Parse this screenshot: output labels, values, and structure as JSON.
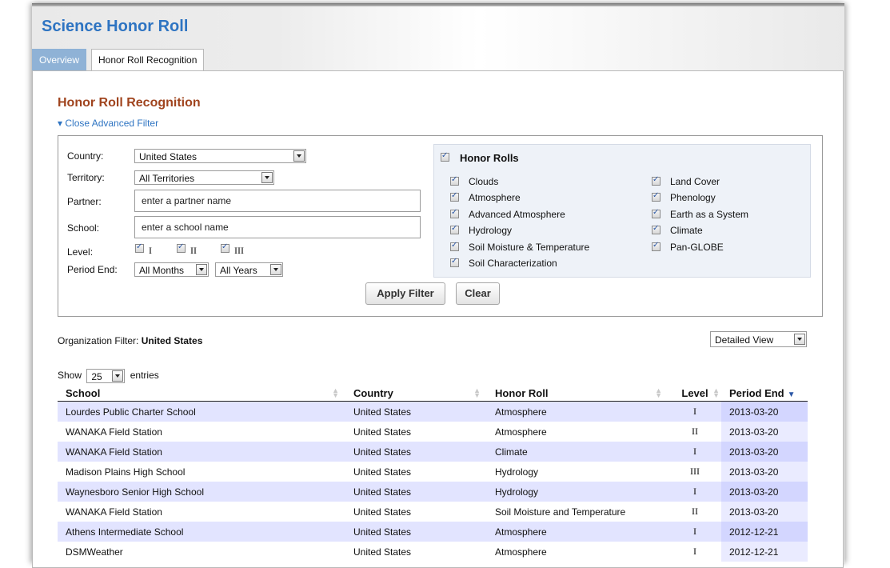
{
  "app": {
    "title": "Science Honor Roll"
  },
  "tabs": [
    {
      "label": "Overview"
    },
    {
      "label": "Honor Roll Recognition"
    }
  ],
  "section": {
    "title": "Honor Roll Recognition",
    "toggle_label": "▾ Close Advanced Filter"
  },
  "filter": {
    "country_label": "Country:",
    "country_value": "United States",
    "territory_label": "Territory:",
    "territory_value": "All Territories",
    "partner_label": "Partner:",
    "partner_placeholder": "enter a partner name",
    "school_label": "School:",
    "school_placeholder": "enter a school name",
    "level_label": "Level:",
    "levels": [
      "I",
      "II",
      "III"
    ],
    "period_label": "Period End:",
    "months_value": "All Months",
    "years_value": "All Years",
    "apply_label": "Apply Filter",
    "clear_label": "Clear"
  },
  "honor_rolls": {
    "header": "Honor Rolls",
    "col1": [
      "Clouds",
      "Atmosphere",
      "Advanced Atmosphere",
      "Hydrology",
      "Soil Moisture & Temperature",
      "Soil Characterization"
    ],
    "col2": [
      "Land Cover",
      "Phenology",
      "Earth as a System",
      "Climate",
      "Pan-GLOBE"
    ]
  },
  "org_filter": {
    "label": "Organization Filter:",
    "value": "United States"
  },
  "view_select": {
    "value": "Detailed View"
  },
  "entries": {
    "show_label": "Show",
    "count": "25",
    "entries_label": "entries"
  },
  "table": {
    "columns": [
      "School",
      "Country",
      "Honor Roll",
      "Level",
      "Period End"
    ],
    "rows": [
      [
        "Lourdes Public Charter School",
        "United States",
        "Atmosphere",
        "I",
        "2013-03-20"
      ],
      [
        "WANAKA Field Station",
        "United States",
        "Atmosphere",
        "II",
        "2013-03-20"
      ],
      [
        "WANAKA Field Station",
        "United States",
        "Climate",
        "I",
        "2013-03-20"
      ],
      [
        "Madison Plains High School",
        "United States",
        "Hydrology",
        "III",
        "2013-03-20"
      ],
      [
        "Waynesboro Senior High School",
        "United States",
        "Hydrology",
        "I",
        "2013-03-20"
      ],
      [
        "WANAKA Field Station",
        "United States",
        "Soil Moisture and Temperature",
        "II",
        "2013-03-20"
      ],
      [
        "Athens Intermediate School",
        "United States",
        "Atmosphere",
        "I",
        "2012-12-21"
      ],
      [
        "DSMWeather",
        "United States",
        "Atmosphere",
        "I",
        "2012-12-21"
      ]
    ]
  }
}
